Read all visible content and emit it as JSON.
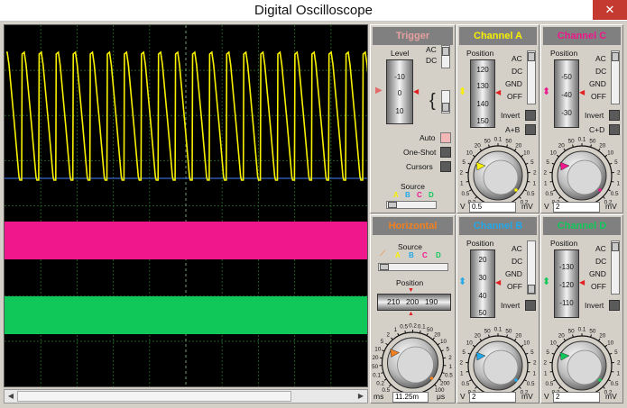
{
  "window": {
    "title": "Digital Oscilloscope",
    "close_glyph": "✕"
  },
  "scroll": {
    "left_arrow": "◀",
    "right_arrow": "▶"
  },
  "colors": {
    "channel_a": "#f7f000",
    "channel_b": "#22a8e8",
    "channel_c": "#f0168c",
    "channel_d": "#10c85a",
    "trigger_title": "#e6a0a0",
    "horizontal_title": "#f08020",
    "grid": "#1f5a1f"
  },
  "trigger": {
    "title": "Trigger",
    "level_label": "Level",
    "level_ticks": [
      "-10",
      "0",
      "10"
    ],
    "coupling": [
      "AC",
      "DC"
    ],
    "modes": [
      "Auto",
      "One-Shot",
      "Cursors"
    ],
    "source_label": "Source",
    "source_letters": [
      "A",
      "B",
      "C",
      "D"
    ],
    "brace_glyph": "{"
  },
  "channel_a": {
    "title": "Channel A",
    "position_label": "Position",
    "position_ticks": [
      "120",
      "130",
      "140",
      "150"
    ],
    "coupling": [
      "AC",
      "DC",
      "GND",
      "OFF"
    ],
    "invert_label": "Invert",
    "combine_label": "A+B",
    "dial_ticks": [
      "0.2",
      "0.5",
      "1",
      "2",
      "5",
      "10",
      "20",
      "50",
      "0.1",
      "50",
      "20",
      "10",
      "5",
      "2",
      "1",
      "0.5",
      "0.2"
    ],
    "unit_left": "V",
    "unit_right": "mV",
    "value": "0.5"
  },
  "channel_c": {
    "title": "Channel C",
    "position_label": "Position",
    "position_ticks": [
      "-50",
      "-40",
      "-30"
    ],
    "coupling": [
      "AC",
      "DC",
      "GND",
      "OFF"
    ],
    "invert_label": "Invert",
    "combine_label": "C+D",
    "dial_ticks": [
      "0.2",
      "0.5",
      "1",
      "2",
      "5",
      "10",
      "20",
      "50",
      "0.1",
      "50",
      "20",
      "10",
      "5",
      "2",
      "1",
      "0.5",
      "0.2"
    ],
    "unit_left": "V",
    "unit_right": "mV",
    "value": "2"
  },
  "horizontal": {
    "title": "Horizontal",
    "source_label": "Source",
    "source_letters": [
      "A",
      "B",
      "C",
      "D"
    ],
    "position_label": "Position",
    "position_ticks": [
      "210",
      "200",
      "190"
    ],
    "dial_ticks": [
      "0.5",
      "0.2",
      "0.1",
      "50",
      "20",
      "10",
      "5",
      "2",
      "1",
      "0.5",
      "0.2",
      "0.1",
      "50",
      "20",
      "10",
      "5",
      "2",
      "1",
      "0.5",
      "200",
      "100"
    ],
    "unit_left": "ms",
    "unit_right": "μs",
    "value": "11.25m"
  },
  "channel_b": {
    "title": "Channel B",
    "position_label": "Position",
    "position_ticks": [
      "20",
      "30",
      "40",
      "50"
    ],
    "coupling": [
      "AC",
      "DC",
      "GND",
      "OFF"
    ],
    "invert_label": "Invert",
    "dial_ticks": [
      "0.2",
      "0.5",
      "1",
      "2",
      "5",
      "10",
      "20",
      "50",
      "0.1",
      "50",
      "20",
      "10",
      "5",
      "2",
      "1",
      "0.5",
      "0.2"
    ],
    "unit_left": "V",
    "unit_right": "mV",
    "value": "2"
  },
  "channel_d": {
    "title": "Channel D",
    "position_label": "Position",
    "position_ticks": [
      "-130",
      "-120",
      "-110"
    ],
    "coupling": [
      "AC",
      "DC",
      "GND",
      "OFF"
    ],
    "invert_label": "Invert",
    "dial_ticks": [
      "0.2",
      "0.5",
      "1",
      "2",
      "5",
      "10",
      "20",
      "50",
      "0.1",
      "50",
      "20",
      "10",
      "5",
      "2",
      "1",
      "0.5",
      "0.2"
    ],
    "unit_left": "V",
    "unit_right": "mV",
    "value": "2"
  }
}
